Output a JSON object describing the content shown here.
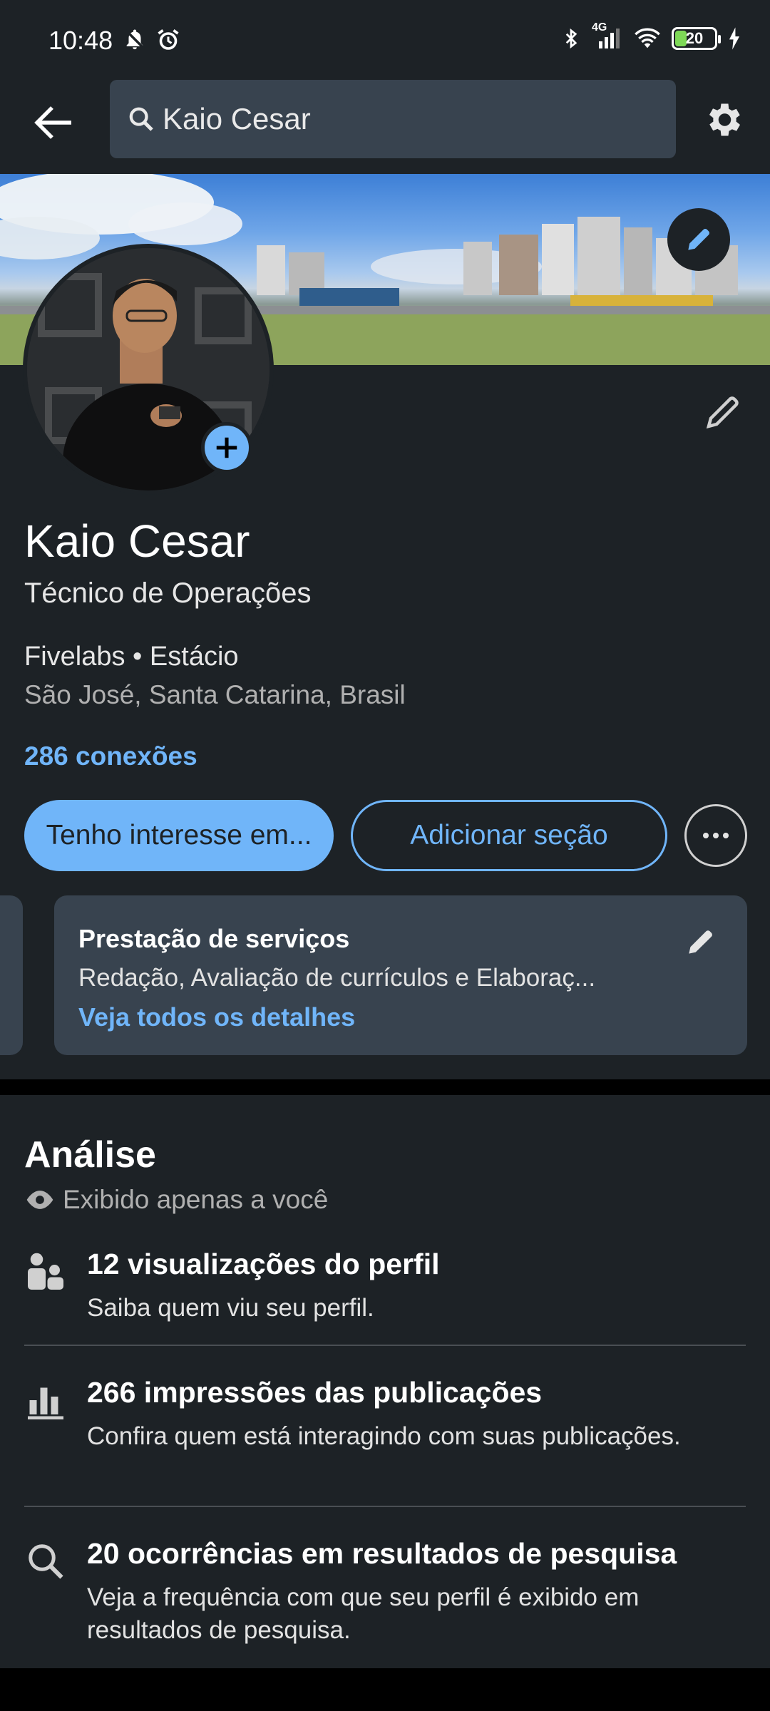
{
  "status_bar": {
    "time": "10:48",
    "network": "4G",
    "battery": "20",
    "icons": [
      "bell-muted-icon",
      "alarm-icon",
      "bluetooth-icon",
      "signal-icon",
      "wifi-icon",
      "battery-icon",
      "charging-icon"
    ]
  },
  "header": {
    "search_text": "Kaio Cesar",
    "icons": [
      "back-arrow-icon",
      "search-icon",
      "settings-gear-icon"
    ]
  },
  "profile": {
    "name": "Kaio Cesar",
    "headline": "Técnico de Operações",
    "company_school": "Fivelabs • Estácio",
    "location": "São José, Santa Catarina, Brasil",
    "connections": "286 conexões"
  },
  "actions": {
    "primary_label": "Tenho interesse em...",
    "secondary_label": "Adicionar seção",
    "more_icon": "more-horizontal-icon"
  },
  "services_card": {
    "title": "Prestação de serviços",
    "description": "Redação, Avaliação de currículos e Elaboraç...",
    "link": "Veja todos os detalhes"
  },
  "analytics": {
    "title": "Análise",
    "subtitle": "Exibido apenas a você",
    "items": [
      {
        "headline": "12 visualizações do perfil",
        "desc": "Saiba quem viu seu perfil.",
        "icon": "people-icon"
      },
      {
        "headline": "266 impressões das publicações",
        "desc": "Confira quem está interagindo com suas publicações.",
        "icon": "bar-chart-icon"
      },
      {
        "headline": "20 ocorrências em resultados de pesquisa",
        "desc": "Veja a frequência com que seu perfil é exibido em resultados de pesquisa.",
        "icon": "search-icon"
      }
    ]
  },
  "colors": {
    "background": "#1d2226",
    "accent": "#70b5f9",
    "card": "#38434f"
  }
}
